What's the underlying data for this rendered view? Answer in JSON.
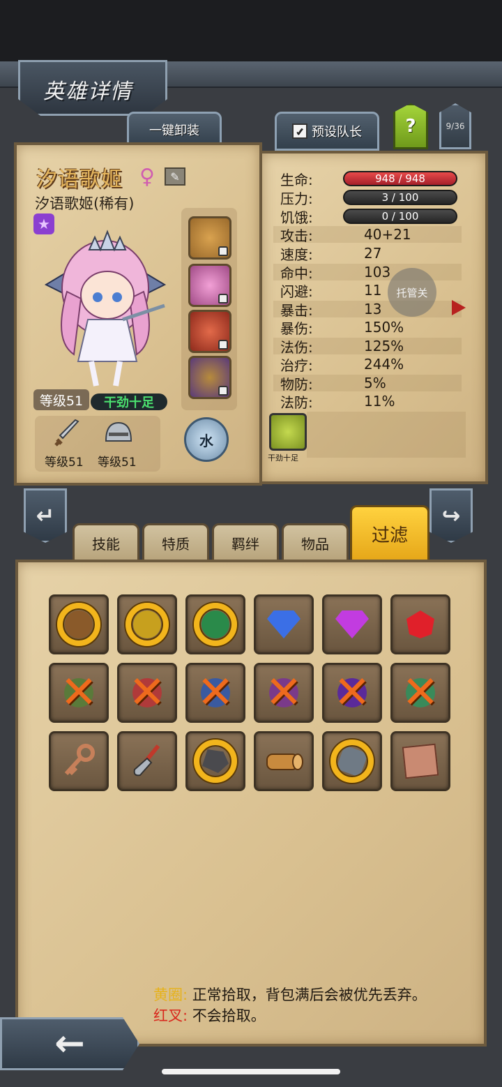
{
  "header": {
    "title": "英雄详情"
  },
  "toolbar": {
    "unequip_label": "一键卸装",
    "leader_label": "预设队长",
    "leader_checked": "✓",
    "help_label": "?",
    "page_count": "9/36"
  },
  "hero": {
    "name": "汐语歌姬",
    "gender_icon": "female-symbol",
    "subname": "汐语歌姬(稀有)",
    "rarity_icon": "purple-star",
    "level": "等级51",
    "trait": "干劲十足",
    "weapon_level": "等级51",
    "armor_level": "等级51",
    "element": "水"
  },
  "stats": {
    "hp": {
      "label": "生命:",
      "value": "948 / 948"
    },
    "stress": {
      "label": "压力:",
      "value": "3 / 100"
    },
    "hunger": {
      "label": "饥饿:",
      "value": "0 / 100"
    },
    "rows": [
      {
        "label": "攻击:",
        "value": "40+21"
      },
      {
        "label": "速度:",
        "value": "27"
      },
      {
        "label": "命中:",
        "value": "103"
      },
      {
        "label": "闪避:",
        "value": "11"
      },
      {
        "label": "暴击:",
        "value": "13"
      },
      {
        "label": "暴伤:",
        "value": "150%"
      },
      {
        "label": "法伤:",
        "value": "125%"
      },
      {
        "label": "治疗:",
        "value": "244%"
      },
      {
        "label": "物防:",
        "value": "5%"
      },
      {
        "label": "法防:",
        "value": "11%"
      }
    ],
    "trait_caption": "干劲十足",
    "autopilot": "托管关"
  },
  "tabs": [
    "技能",
    "特质",
    "羁绊",
    "物品",
    "过滤"
  ],
  "legend": {
    "yellow_key": "黄圈:",
    "yellow_text": "正常拾取，背包满后会被优先丢弃。",
    "red_key": "红叉:",
    "red_text": "不会拾取。"
  },
  "colors": {
    "accent": "#f2b51c",
    "cross": "#ee6a1d",
    "hp": "#d33a3a"
  }
}
